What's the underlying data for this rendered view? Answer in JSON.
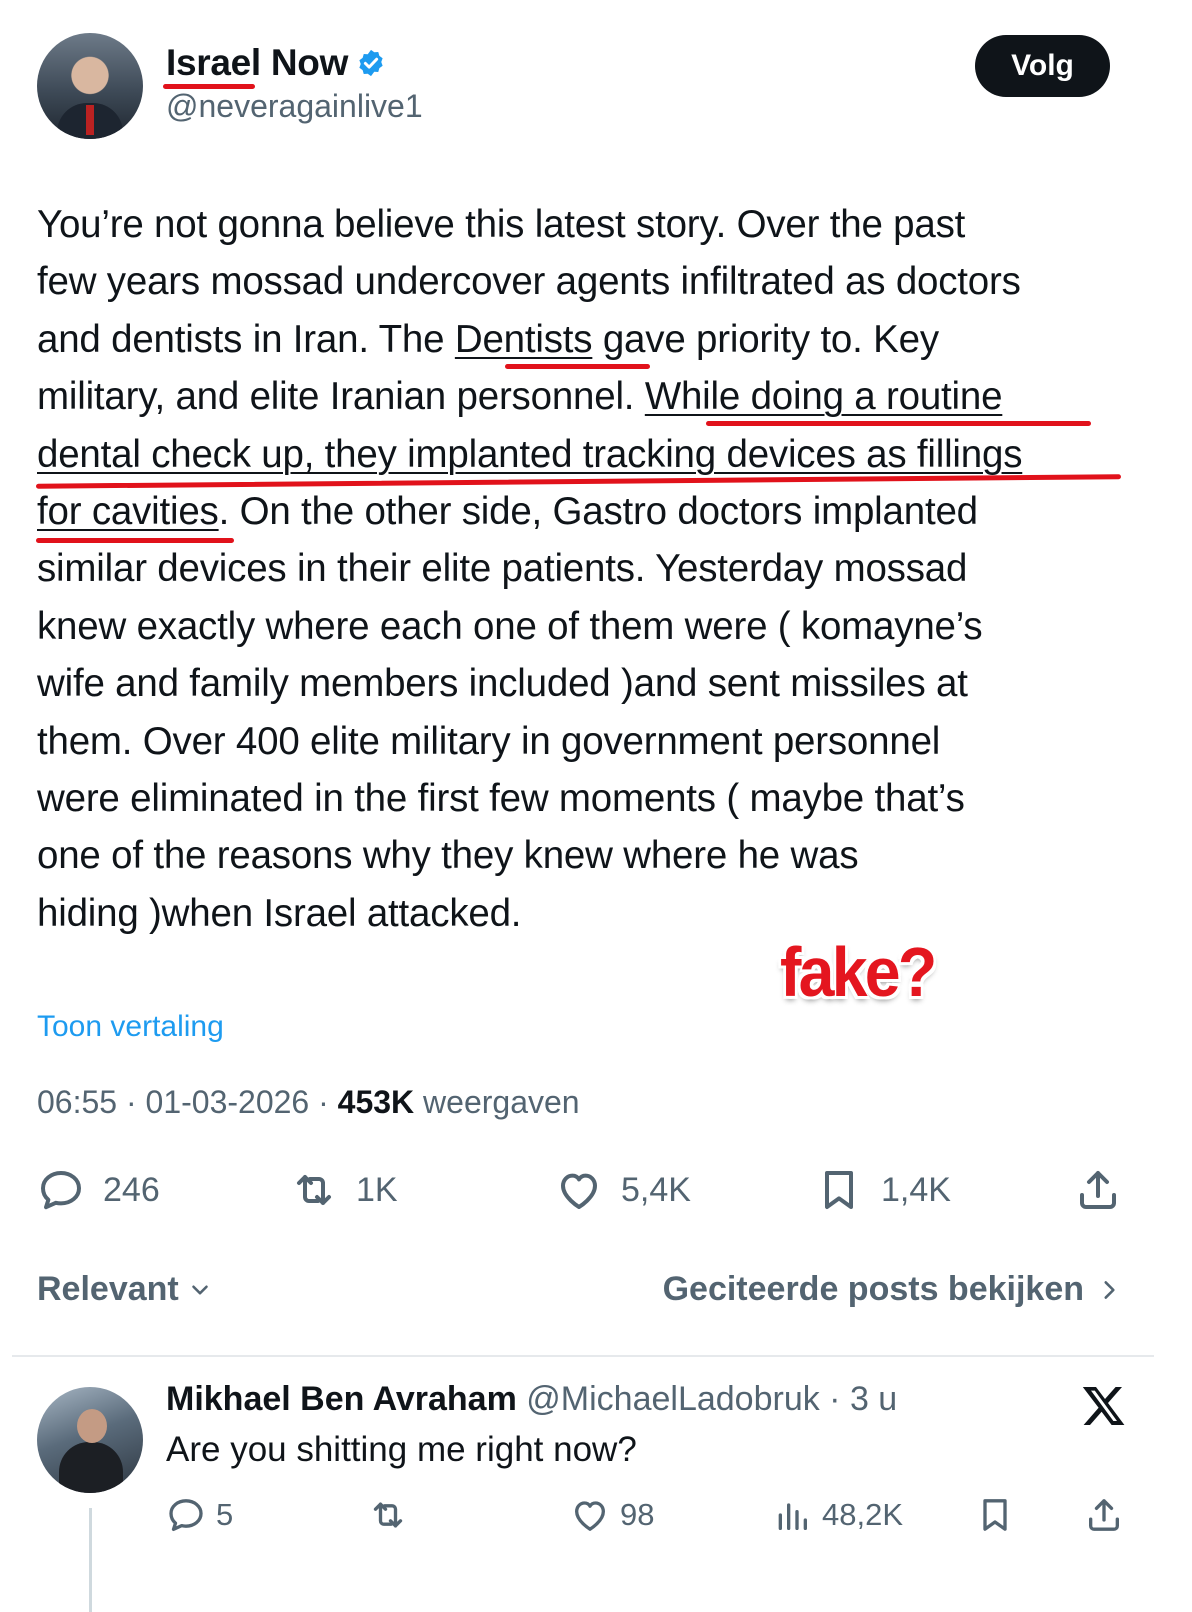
{
  "author": {
    "display_name": "Israel Now",
    "handle": "@neveragainlive1",
    "follow_label": "Volg"
  },
  "tweet": {
    "lines": [
      [
        "You’re not gonna believe this latest story. Over the past"
      ],
      [
        "few years mossad undercover agents infiltrated as doctors"
      ],
      [
        "and dentists  in Iran. The ",
        "Dentists",
        " gave priority to. Key"
      ],
      [
        "military, and elite Iranian personnel. ",
        "While doing a routine",
        ""
      ],
      [
        "",
        "dental check up, they implanted tracking devices as fillings",
        ""
      ],
      [
        "",
        "for cavities",
        ". On the other side, Gastro doctors implanted"
      ],
      [
        "similar devices in their elite patients. Yesterday mossad"
      ],
      [
        "knew exactly where each one of them were ( komayne’s"
      ],
      [
        "wife and family members included )and sent missiles at"
      ],
      [
        "them. Over 400 elite military in government personnel"
      ],
      [
        "were eliminated in the first few moments ( maybe that’s"
      ],
      [
        "one of the reasons why they knew where he was"
      ],
      [
        "hiding )when Israel attacked."
      ]
    ],
    "translate_label": "Toon vertaling",
    "time": "06:55",
    "date": "01-03-2026",
    "views_count": "453K",
    "views_label": "weergaven"
  },
  "stamp_text": "fake?",
  "actions": {
    "replies": "246",
    "reposts": "1K",
    "likes": "5,4K",
    "bookmarks": "1,4K"
  },
  "sort": {
    "label": "Relevant",
    "quotes_link": "Geciteerde posts bekijken"
  },
  "reply": {
    "name": "Mikhael Ben Avraham",
    "handle": "@MichaelLadobruk",
    "age": "3 u",
    "text": "Are you shitting me right now?",
    "replies": "5",
    "likes": "98",
    "views": "48,2K"
  },
  "colors": {
    "accent": "#1d9bf0",
    "marker": "#e1121b",
    "muted": "#536471"
  }
}
